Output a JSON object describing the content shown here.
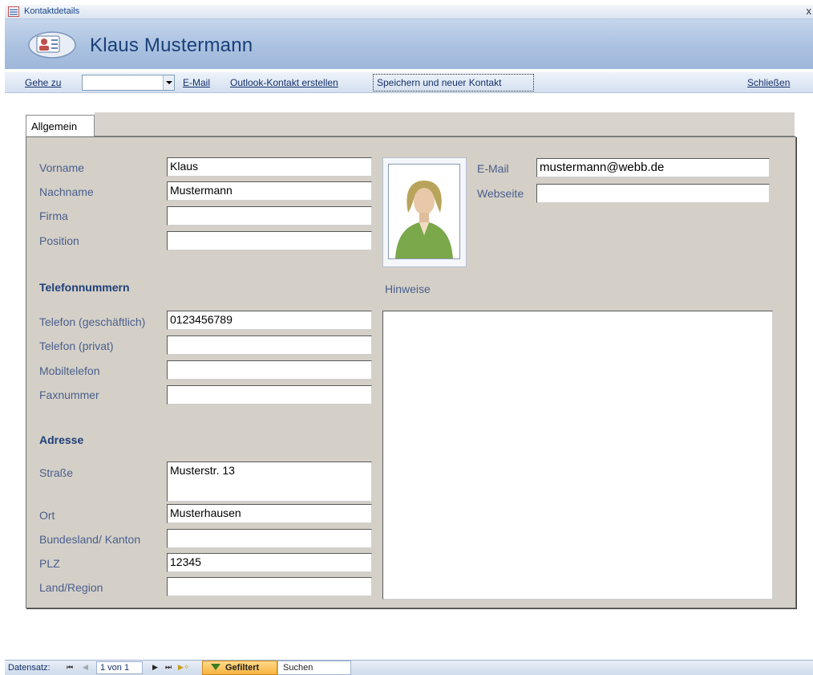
{
  "window": {
    "title": "Kontaktdetails",
    "close_glyph": "x"
  },
  "header": {
    "title": "Klaus Mustermann",
    "icon": "contact-card-icon"
  },
  "toolbar": {
    "goto_label": "Gehe zu",
    "goto_value": "",
    "email_label": "E-Mail",
    "outlook_label": "Outlook-Kontakt erstellen",
    "save_new_label": "Speichern und neuer Kontakt",
    "close_label": "Schließen"
  },
  "tab": {
    "label": "Allgemein"
  },
  "labels": {
    "first_name": "Vorname",
    "last_name": "Nachname",
    "company": "Firma",
    "position": "Position",
    "email": "E-Mail",
    "website": "Webseite",
    "phone_section": "Telefonnummern",
    "notes": "Hinweise",
    "phone_business": "Telefon (geschäftlich)",
    "phone_private": "Telefon (privat)",
    "mobile": "Mobiltelefon",
    "fax": "Faxnummer",
    "address_section": "Adresse",
    "street": "Straße",
    "city": "Ort",
    "state": "Bundesland/ Kanton",
    "zip": "PLZ",
    "country": "Land/Region"
  },
  "values": {
    "first_name": "Klaus",
    "last_name": "Mustermann",
    "company": "",
    "position": "",
    "email": "mustermann@webb.de",
    "website": "",
    "phone_business": "0123456789",
    "phone_private": "",
    "mobile": "",
    "fax": "",
    "street": "Musterstr. 13",
    "city": "Musterhausen",
    "state": "",
    "zip": "12345",
    "country": "",
    "notes": ""
  },
  "statusbar": {
    "record_label": "Datensatz:",
    "record_value": "1 von 1",
    "filter_label": "Gefiltert",
    "search_label": "Suchen"
  },
  "colors": {
    "label": "#4a5e8c",
    "section": "#1f3f78",
    "panel": "#d4d0c8",
    "header": "#aac1e0"
  }
}
